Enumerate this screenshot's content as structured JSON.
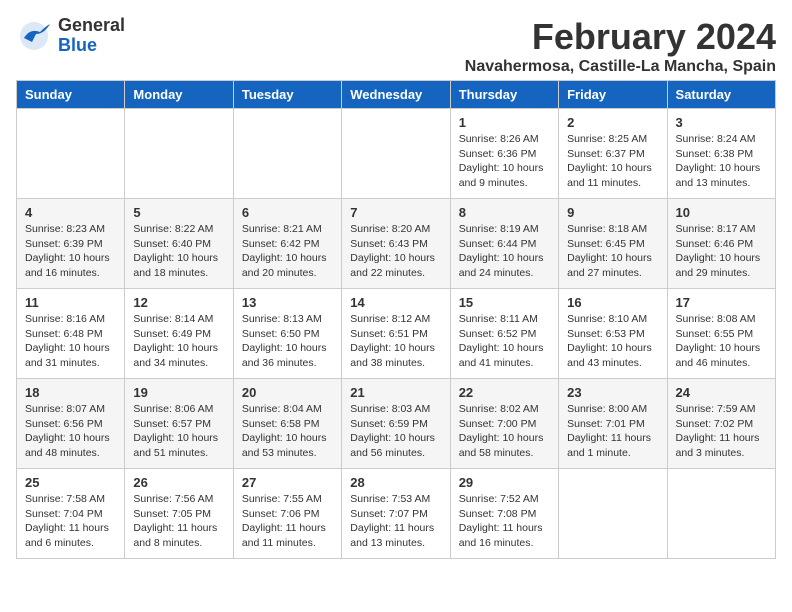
{
  "header": {
    "logo_general": "General",
    "logo_blue": "Blue",
    "month_title": "February 2024",
    "location": "Navahermosa, Castille-La Mancha, Spain"
  },
  "days_of_week": [
    "Sunday",
    "Monday",
    "Tuesday",
    "Wednesday",
    "Thursday",
    "Friday",
    "Saturday"
  ],
  "weeks": [
    {
      "days": [
        {
          "num": "",
          "info": ""
        },
        {
          "num": "",
          "info": ""
        },
        {
          "num": "",
          "info": ""
        },
        {
          "num": "",
          "info": ""
        },
        {
          "num": "1",
          "info": "Sunrise: 8:26 AM\nSunset: 6:36 PM\nDaylight: 10 hours\nand 9 minutes."
        },
        {
          "num": "2",
          "info": "Sunrise: 8:25 AM\nSunset: 6:37 PM\nDaylight: 10 hours\nand 11 minutes."
        },
        {
          "num": "3",
          "info": "Sunrise: 8:24 AM\nSunset: 6:38 PM\nDaylight: 10 hours\nand 13 minutes."
        }
      ]
    },
    {
      "days": [
        {
          "num": "4",
          "info": "Sunrise: 8:23 AM\nSunset: 6:39 PM\nDaylight: 10 hours\nand 16 minutes."
        },
        {
          "num": "5",
          "info": "Sunrise: 8:22 AM\nSunset: 6:40 PM\nDaylight: 10 hours\nand 18 minutes."
        },
        {
          "num": "6",
          "info": "Sunrise: 8:21 AM\nSunset: 6:42 PM\nDaylight: 10 hours\nand 20 minutes."
        },
        {
          "num": "7",
          "info": "Sunrise: 8:20 AM\nSunset: 6:43 PM\nDaylight: 10 hours\nand 22 minutes."
        },
        {
          "num": "8",
          "info": "Sunrise: 8:19 AM\nSunset: 6:44 PM\nDaylight: 10 hours\nand 24 minutes."
        },
        {
          "num": "9",
          "info": "Sunrise: 8:18 AM\nSunset: 6:45 PM\nDaylight: 10 hours\nand 27 minutes."
        },
        {
          "num": "10",
          "info": "Sunrise: 8:17 AM\nSunset: 6:46 PM\nDaylight: 10 hours\nand 29 minutes."
        }
      ]
    },
    {
      "days": [
        {
          "num": "11",
          "info": "Sunrise: 8:16 AM\nSunset: 6:48 PM\nDaylight: 10 hours\nand 31 minutes."
        },
        {
          "num": "12",
          "info": "Sunrise: 8:14 AM\nSunset: 6:49 PM\nDaylight: 10 hours\nand 34 minutes."
        },
        {
          "num": "13",
          "info": "Sunrise: 8:13 AM\nSunset: 6:50 PM\nDaylight: 10 hours\nand 36 minutes."
        },
        {
          "num": "14",
          "info": "Sunrise: 8:12 AM\nSunset: 6:51 PM\nDaylight: 10 hours\nand 38 minutes."
        },
        {
          "num": "15",
          "info": "Sunrise: 8:11 AM\nSunset: 6:52 PM\nDaylight: 10 hours\nand 41 minutes."
        },
        {
          "num": "16",
          "info": "Sunrise: 8:10 AM\nSunset: 6:53 PM\nDaylight: 10 hours\nand 43 minutes."
        },
        {
          "num": "17",
          "info": "Sunrise: 8:08 AM\nSunset: 6:55 PM\nDaylight: 10 hours\nand 46 minutes."
        }
      ]
    },
    {
      "days": [
        {
          "num": "18",
          "info": "Sunrise: 8:07 AM\nSunset: 6:56 PM\nDaylight: 10 hours\nand 48 minutes."
        },
        {
          "num": "19",
          "info": "Sunrise: 8:06 AM\nSunset: 6:57 PM\nDaylight: 10 hours\nand 51 minutes."
        },
        {
          "num": "20",
          "info": "Sunrise: 8:04 AM\nSunset: 6:58 PM\nDaylight: 10 hours\nand 53 minutes."
        },
        {
          "num": "21",
          "info": "Sunrise: 8:03 AM\nSunset: 6:59 PM\nDaylight: 10 hours\nand 56 minutes."
        },
        {
          "num": "22",
          "info": "Sunrise: 8:02 AM\nSunset: 7:00 PM\nDaylight: 10 hours\nand 58 minutes."
        },
        {
          "num": "23",
          "info": "Sunrise: 8:00 AM\nSunset: 7:01 PM\nDaylight: 11 hours\nand 1 minute."
        },
        {
          "num": "24",
          "info": "Sunrise: 7:59 AM\nSunset: 7:02 PM\nDaylight: 11 hours\nand 3 minutes."
        }
      ]
    },
    {
      "days": [
        {
          "num": "25",
          "info": "Sunrise: 7:58 AM\nSunset: 7:04 PM\nDaylight: 11 hours\nand 6 minutes."
        },
        {
          "num": "26",
          "info": "Sunrise: 7:56 AM\nSunset: 7:05 PM\nDaylight: 11 hours\nand 8 minutes."
        },
        {
          "num": "27",
          "info": "Sunrise: 7:55 AM\nSunset: 7:06 PM\nDaylight: 11 hours\nand 11 minutes."
        },
        {
          "num": "28",
          "info": "Sunrise: 7:53 AM\nSunset: 7:07 PM\nDaylight: 11 hours\nand 13 minutes."
        },
        {
          "num": "29",
          "info": "Sunrise: 7:52 AM\nSunset: 7:08 PM\nDaylight: 11 hours\nand 16 minutes."
        },
        {
          "num": "",
          "info": ""
        },
        {
          "num": "",
          "info": ""
        }
      ]
    }
  ]
}
